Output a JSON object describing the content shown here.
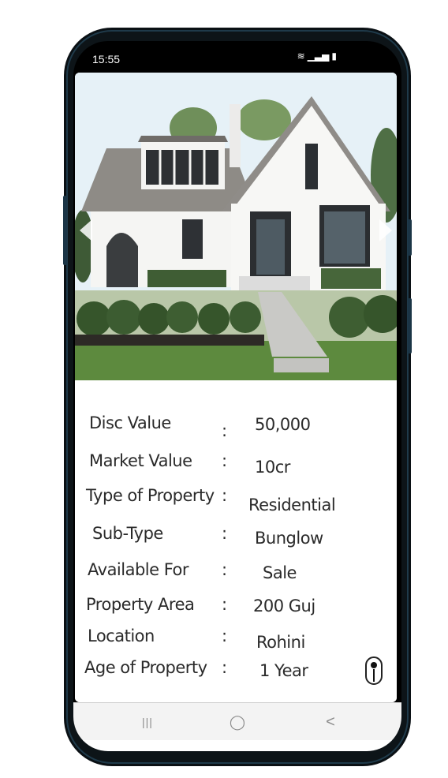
{
  "status_bar": {
    "time": "15:55",
    "icons": [
      "wifi-icon",
      "signal-icon",
      "battery-icon"
    ]
  },
  "gallery": {
    "image_description": "house-photo",
    "prev_icon": "chevron-left-icon",
    "next_icon": "chevron-right-icon"
  },
  "details": {
    "separator": ":",
    "rows": [
      {
        "label": "Disc Value",
        "value": "50,000"
      },
      {
        "label": "Market Value",
        "value": "10cr"
      },
      {
        "label": "Type of Property",
        "value": "Residential"
      },
      {
        "label": "Sub-Type",
        "value": "Bunglow"
      },
      {
        "label": "Available For",
        "value": "Sale"
      },
      {
        "label": "Property Area",
        "value": "200 Guj"
      },
      {
        "label": "Location",
        "value": "Rohini"
      },
      {
        "label": "Age of Property",
        "value": "1 Year"
      }
    ],
    "info_icon": "info-icon"
  },
  "nav_bar": {
    "recents": "|||",
    "home": "◯",
    "back": "<"
  },
  "colors": {
    "phone_frame": "#0d1418",
    "accent_frame": "#1b3546",
    "text": "#2a2a2a"
  }
}
